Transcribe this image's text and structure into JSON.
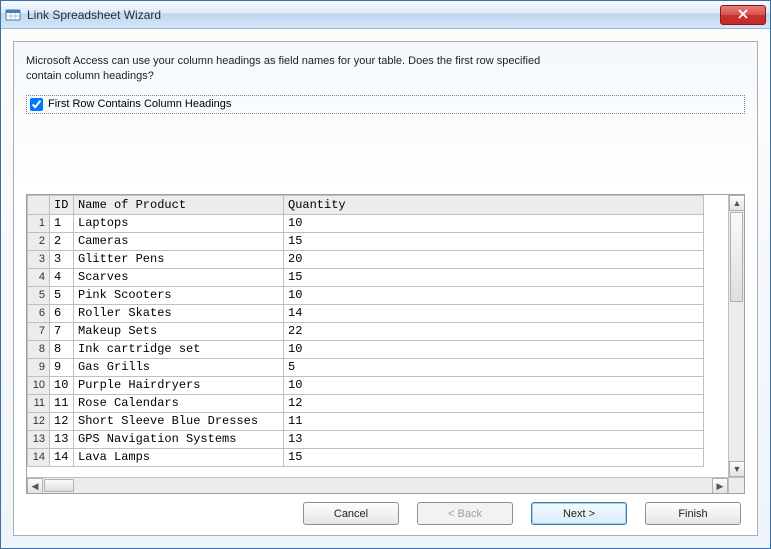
{
  "title": "Link Spreadsheet Wizard",
  "intro_text": "Microsoft Access can use your column headings as field names for your table. Does the first row specified contain column headings?",
  "checkbox_label": "First Row Contains Column Headings",
  "checkbox_checked": true,
  "columns": [
    "ID",
    "Name of Product",
    "Quantity"
  ],
  "chart_data": {
    "type": "table",
    "columns": [
      "ID",
      "Name of Product",
      "Quantity"
    ],
    "rows": [
      [
        "1",
        "Laptops",
        "10"
      ],
      [
        "2",
        "Cameras",
        "15"
      ],
      [
        "3",
        "Glitter Pens",
        "20"
      ],
      [
        "4",
        "Scarves",
        "15"
      ],
      [
        "5",
        "Pink Scooters",
        "10"
      ],
      [
        "6",
        "Roller Skates",
        "14"
      ],
      [
        "7",
        "Makeup Sets",
        "22"
      ],
      [
        "8",
        "Ink cartridge set",
        "10"
      ],
      [
        "9",
        "Gas Grills",
        "5"
      ],
      [
        "10",
        "Purple Hairdryers",
        "10"
      ],
      [
        "11",
        "Rose Calendars",
        "12"
      ],
      [
        "12",
        "Short Sleeve Blue Dresses",
        "11"
      ],
      [
        "13",
        "GPS Navigation Systems",
        "13"
      ],
      [
        "14",
        "Lava Lamps",
        "15"
      ]
    ]
  },
  "buttons": {
    "cancel": "Cancel",
    "back": "< Back",
    "next": "Next >",
    "finish": "Finish"
  }
}
